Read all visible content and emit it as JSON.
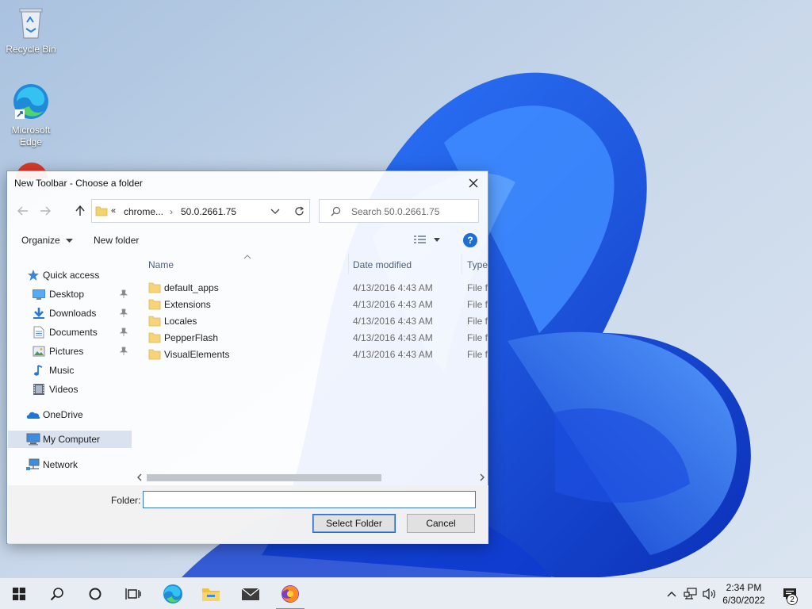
{
  "desktop": {
    "icons": [
      {
        "label": "Recycle Bin"
      },
      {
        "label": "Microsoft Edge"
      }
    ]
  },
  "dialog": {
    "title": "New Toolbar - Choose a folder",
    "address": {
      "overflow": "«",
      "crumbs": [
        "chrome...",
        "50.0.2661.75"
      ]
    },
    "search": {
      "placeholder": "Search 50.0.2661.75"
    },
    "toolbar": {
      "organize": "Organize",
      "new_folder": "New folder"
    },
    "nav_pane": {
      "items": [
        {
          "label": "Quick access",
          "icon": "star-icon"
        },
        {
          "label": "Desktop",
          "icon": "desktop-folder-icon",
          "pinned": true
        },
        {
          "label": "Downloads",
          "icon": "downloads-icon",
          "pinned": true
        },
        {
          "label": "Documents",
          "icon": "documents-icon",
          "pinned": true
        },
        {
          "label": "Pictures",
          "icon": "pictures-icon",
          "pinned": true
        },
        {
          "label": "Music",
          "icon": "music-icon"
        },
        {
          "label": "Videos",
          "icon": "videos-icon"
        },
        {
          "label": "OneDrive",
          "icon": "cloud-icon"
        },
        {
          "label": "My Computer",
          "icon": "computer-icon",
          "selected": true
        },
        {
          "label": "Network",
          "icon": "network-icon"
        }
      ]
    },
    "file_list": {
      "columns": [
        "Name",
        "Date modified",
        "Type"
      ],
      "rows": [
        {
          "name": "default_apps",
          "date": "4/13/2016 4:43 AM",
          "type": "File folder"
        },
        {
          "name": "Extensions",
          "date": "4/13/2016 4:43 AM",
          "type": "File folder"
        },
        {
          "name": "Locales",
          "date": "4/13/2016 4:43 AM",
          "type": "File folder"
        },
        {
          "name": "PepperFlash",
          "date": "4/13/2016 4:43 AM",
          "type": "File folder"
        },
        {
          "name": "VisualElements",
          "date": "4/13/2016 4:43 AM",
          "type": "File folder"
        }
      ]
    },
    "folder_field": {
      "label": "Folder:",
      "value": ""
    },
    "buttons": {
      "select": "Select Folder",
      "cancel": "Cancel"
    }
  },
  "taskbar": {
    "clock": {
      "time": "2:34 PM",
      "date": "6/30/2022"
    },
    "notifications": "2"
  }
}
